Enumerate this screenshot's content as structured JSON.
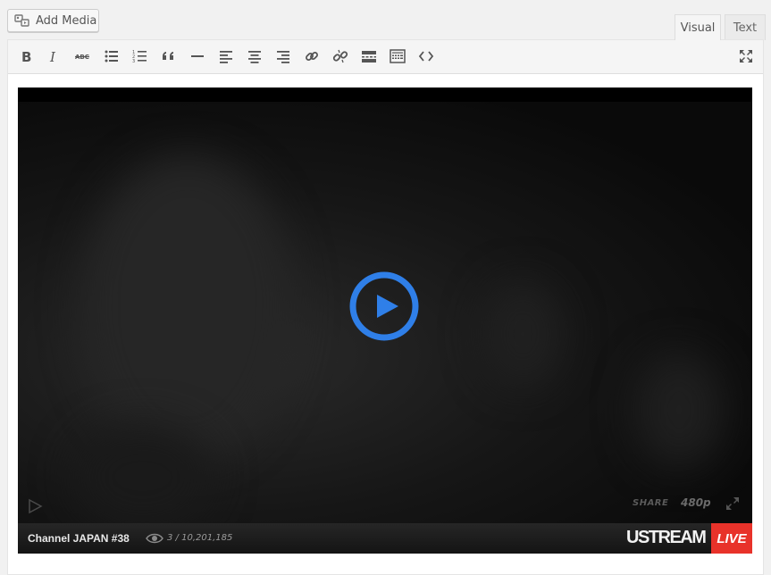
{
  "header": {
    "add_media_label": "Add Media",
    "tabs": [
      {
        "label": "Visual",
        "active": true
      },
      {
        "label": "Text",
        "active": false
      }
    ]
  },
  "toolbar": {
    "buttons": [
      "bold-icon",
      "italic-icon",
      "strikethrough-icon",
      "bullet-list-icon",
      "numbered-list-icon",
      "blockquote-icon",
      "horizontal-rule-icon",
      "align-left-icon",
      "align-center-icon",
      "align-right-icon",
      "link-icon",
      "unlink-icon",
      "read-more-icon",
      "toolbar-toggle-icon",
      "code-icon",
      "fullscreen-icon"
    ]
  },
  "video": {
    "channel_title": "Channel JAPAN #38",
    "view_count": "3 / 10,201,185",
    "share_label": "SHARE",
    "quality_label": "480p",
    "brand_label": "USTREAM",
    "live_label": "LIVE"
  },
  "colors": {
    "play_button": "#2f7fe8",
    "live_badge": "#e8322a",
    "background": "#f1f1f1"
  }
}
